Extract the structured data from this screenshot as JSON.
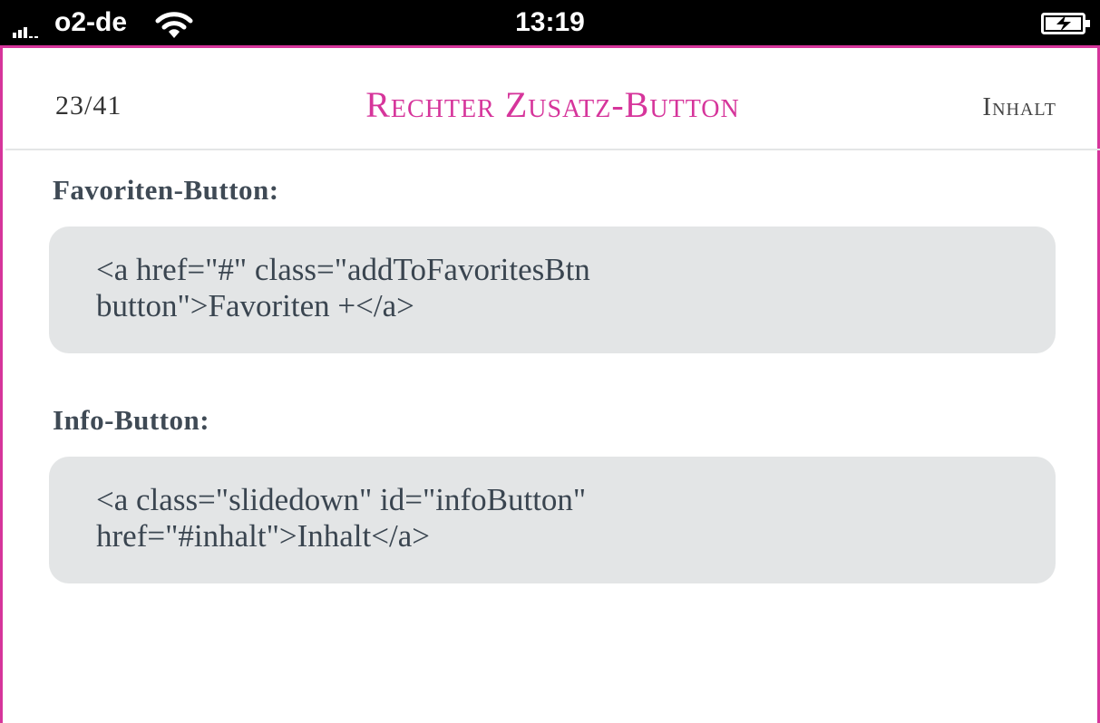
{
  "status_bar": {
    "carrier": "o2-de",
    "time": "13:19",
    "signal_icon": "signal-bars-icon",
    "wifi_icon": "wifi-icon",
    "battery_icon": "battery-charging-icon"
  },
  "nav": {
    "page_counter": "23/41",
    "title": "Rechter Zusatz-Button",
    "right_link": "Inhalt"
  },
  "sections": [
    {
      "heading": "Favoriten-Button:",
      "code": "<a href=\"#\" class=\"addToFavoritesBtn\nbutton\">Favoriten +</a>"
    },
    {
      "heading": "Info-Button:",
      "code": "<a class=\"slidedown\" id=\"infoButton\"\nhref=\"#inhalt\">Inhalt</a>"
    }
  ],
  "colors": {
    "accent": "#d6359b",
    "code_background": "#e3e5e6",
    "text": "#3a4550"
  }
}
